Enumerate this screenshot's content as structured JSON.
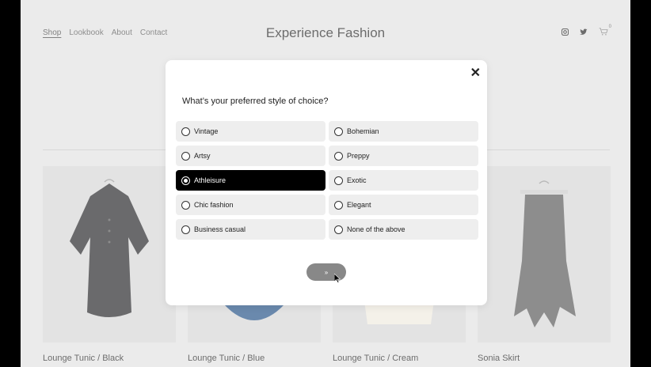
{
  "header": {
    "nav": [
      "Shop",
      "Lookbook",
      "About",
      "Contact"
    ],
    "title": "Experience Fashion",
    "icons": [
      "instagram-icon",
      "twitter-icon",
      "cart-icon"
    ],
    "cart_count": "0"
  },
  "products": [
    {
      "name": "Lounge Tunic / Black"
    },
    {
      "name": "Lounge Tunic / Blue"
    },
    {
      "name": "Lounge Tunic / Cream"
    },
    {
      "name": "Sonia Skirt"
    }
  ],
  "modal": {
    "close": "✕",
    "question": "What’s your preferred style of choice?",
    "options": [
      {
        "label": "Vintage",
        "selected": false
      },
      {
        "label": "Bohemian",
        "selected": false
      },
      {
        "label": "Artsy",
        "selected": false
      },
      {
        "label": "Preppy",
        "selected": false
      },
      {
        "label": "Athleisure",
        "selected": true
      },
      {
        "label": "Exotic",
        "selected": false
      },
      {
        "label": "Chic fashion",
        "selected": false
      },
      {
        "label": "Elegant",
        "selected": false
      },
      {
        "label": "Business casual",
        "selected": false
      },
      {
        "label": "None of the above",
        "selected": false
      }
    ],
    "next_label": "»"
  },
  "colors": {
    "selected": "#000000",
    "option_bg": "#eeeeee",
    "button": "#888888"
  }
}
